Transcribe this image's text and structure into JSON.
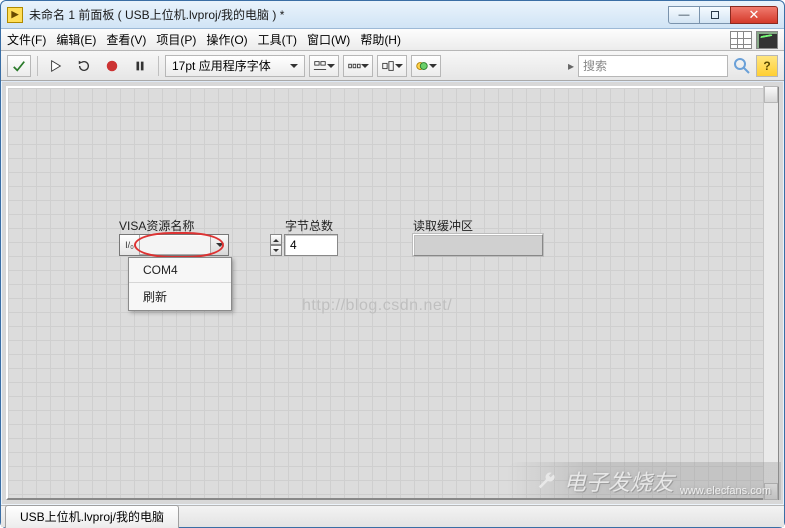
{
  "window": {
    "title": "未命名 1 前面板 ( USB上位机.lvproj/我的电脑 ) *"
  },
  "menu": {
    "items": [
      "文件(F)",
      "编辑(E)",
      "查看(V)",
      "项目(P)",
      "操作(O)",
      "工具(T)",
      "窗口(W)",
      "帮助(H)"
    ]
  },
  "toolbar": {
    "font_select": "17pt 应用程序字体",
    "search_placeholder": "搜索",
    "help_label": "?"
  },
  "panel": {
    "visa": {
      "label": "VISA资源名称",
      "io_glyph": "I/₀",
      "value": "",
      "menu": {
        "items": [
          "COM4",
          "刷新"
        ]
      }
    },
    "bytes": {
      "label": "字节总数",
      "value": "4"
    },
    "readbuf": {
      "label": "读取缓冲区",
      "value": ""
    },
    "watermark": "http://blog.csdn.net/",
    "site_brand": "电子发烧友",
    "site_url": "www.elecfans.com"
  },
  "status": {
    "tab": "USB上位机.lvproj/我的电脑"
  }
}
